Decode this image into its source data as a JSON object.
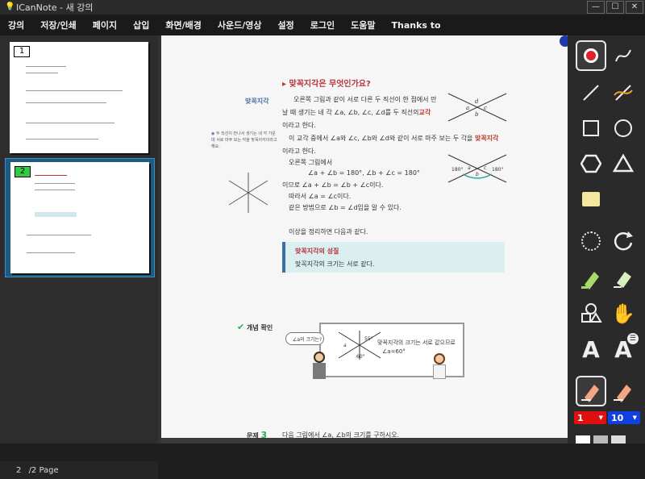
{
  "window": {
    "title": "ICanNote - 새 강의"
  },
  "menu": [
    "강의",
    "저장/인쇄",
    "페이지",
    "삽입",
    "화면/배경",
    "사운드/영상",
    "설정",
    "로그인",
    "도움말",
    "Thanks to"
  ],
  "pages": {
    "thumb1_num": "1",
    "thumb2_num": "2",
    "indicator": "2",
    "total": "/2 Page"
  },
  "content": {
    "heading": "맞꼭지각은 무엇인가요?",
    "side_label": "맞꼭지각",
    "q_text": "두 직선이 만나서 생기는 네 각 가운데 서로 마주 보는 각을 맞꼭지각이라고 해요.",
    "p1": "오른쪽 그림과 같이 서로 다른 두 직선이 한 점에서 만",
    "p1b": "날 때 생기는 네 각 ∠a, ∠b, ∠c, ∠d를 두 직선의",
    "kyogak": "교각",
    "p1c": "이라고 한다.",
    "p2": "이 교각 중에서 ∠a와 ∠c, ∠b와 ∠d와 같이 서로 마주 보는 두 각을",
    "p2k": "맞꼭지각",
    "p2c": "이라고 한다.",
    "p3": "오른쪽 그림에서",
    "eq1": "∠a + ∠b = 180°,  ∠b + ∠c = 180°",
    "eq2": "이므로  ∠a + ∠b = ∠b + ∠c이다.",
    "eq3": "따라서  ∠a = ∠c이다.",
    "eq4": "같은 방법으로  ∠b = ∠d임을 알 수 있다.",
    "p4": "이상을 정리하면 다음과 같다.",
    "box_title": "맞꼭지각의 성질",
    "box_text": "맞꼭지각의 크기는 서로 같다.",
    "check_label": "개념 확인",
    "bubble": "∠a의 크기는?",
    "board_text": "맞꼭지각의 크기는 서로 같으므로",
    "board_eq": "∠a=60°",
    "problem_label": "문제",
    "problem_num": "3",
    "problem_text": "다음 그림에서 ∠a, ∠b의 크기를 구하시오.",
    "fig1": {
      "a": "a",
      "b": "b",
      "c": "c",
      "d": "d"
    },
    "fig2": {
      "l": "180°",
      "r": "180°",
      "a": "a",
      "b": "b",
      "c": "c"
    },
    "board_fig": {
      "a": "a",
      "a55": "55°",
      "a60": "60°"
    }
  },
  "tools": {
    "color_value": "1",
    "size_value": "10",
    "text_a": "A"
  }
}
